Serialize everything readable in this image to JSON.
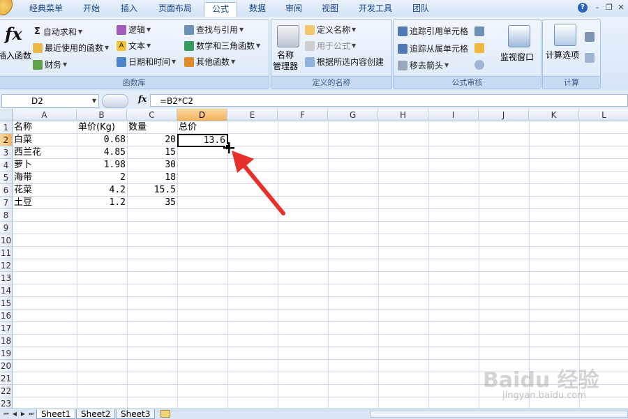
{
  "ribbon": {
    "tabs": [
      "经典菜单",
      "开始",
      "插入",
      "页面布局",
      "公式",
      "数据",
      "审阅",
      "视图",
      "开发工具",
      "团队"
    ],
    "active_tab": "公式",
    "groups": {
      "function_library": {
        "label": "函数库",
        "insert_function": "插入函数",
        "autosum": "自动求和",
        "recent": "最近使用的函数",
        "financial": "财务",
        "logical": "逻辑",
        "text": "文本",
        "datetime": "日期和时间",
        "lookup": "查找与引用",
        "math": "数学和三角函数",
        "more": "其他函数"
      },
      "defined_names": {
        "label": "定义的名称",
        "name_manager_1": "名称",
        "name_manager_2": "管理器",
        "define_name": "定义名称",
        "use_in_formula": "用于公式",
        "create_from_selection": "根据所选内容创建"
      },
      "formula_auditing": {
        "label": "公式审核",
        "trace_precedents": "追踪引用单元格",
        "trace_dependents": "追踪从属单元格",
        "remove_arrows": "移去箭头",
        "watch_window": "监视窗口"
      },
      "calculation": {
        "label": "计算",
        "calc_options": "计算选项"
      }
    }
  },
  "formula_bar": {
    "name_box": "D2",
    "fx_label": "fx",
    "formula": "=B2*C2"
  },
  "grid": {
    "columns": [
      "A",
      "B",
      "C",
      "D",
      "E",
      "F",
      "G",
      "H",
      "I",
      "J",
      "K",
      "L"
    ],
    "selected_column": "D",
    "rows": [
      "1",
      "2",
      "3",
      "4",
      "5",
      "6",
      "7",
      "8",
      "9",
      "10",
      "11",
      "12",
      "13",
      "14",
      "15",
      "16",
      "17",
      "18",
      "19",
      "20",
      "21",
      "22",
      "23"
    ],
    "selected_row": "2",
    "cells": {
      "A1": "名称",
      "B1": "单价(Kg)",
      "C1": "数量",
      "D1": "总价",
      "A2": "白菜",
      "B2": "0.68",
      "C2": "20",
      "D2": "13.6",
      "A3": "西兰花",
      "B3": "4.85",
      "C3": "15",
      "A4": "萝卜",
      "B4": "1.98",
      "C4": "30",
      "A5": "海带",
      "B5": "2",
      "C5": "18",
      "A6": "花菜",
      "B6": "4.2",
      "C6": "15.5",
      "A7": "土豆",
      "B7": "1.2",
      "C7": "35"
    }
  },
  "sheets": [
    "Sheet1",
    "Sheet2",
    "Sheet3"
  ],
  "active_sheet": "Sheet1",
  "watermark": {
    "brand": "Baidu 经验",
    "url": "jingyan.baidu.com"
  },
  "colors": {
    "accent": "#f4b25e",
    "annotation_arrow": "#e8302a"
  }
}
